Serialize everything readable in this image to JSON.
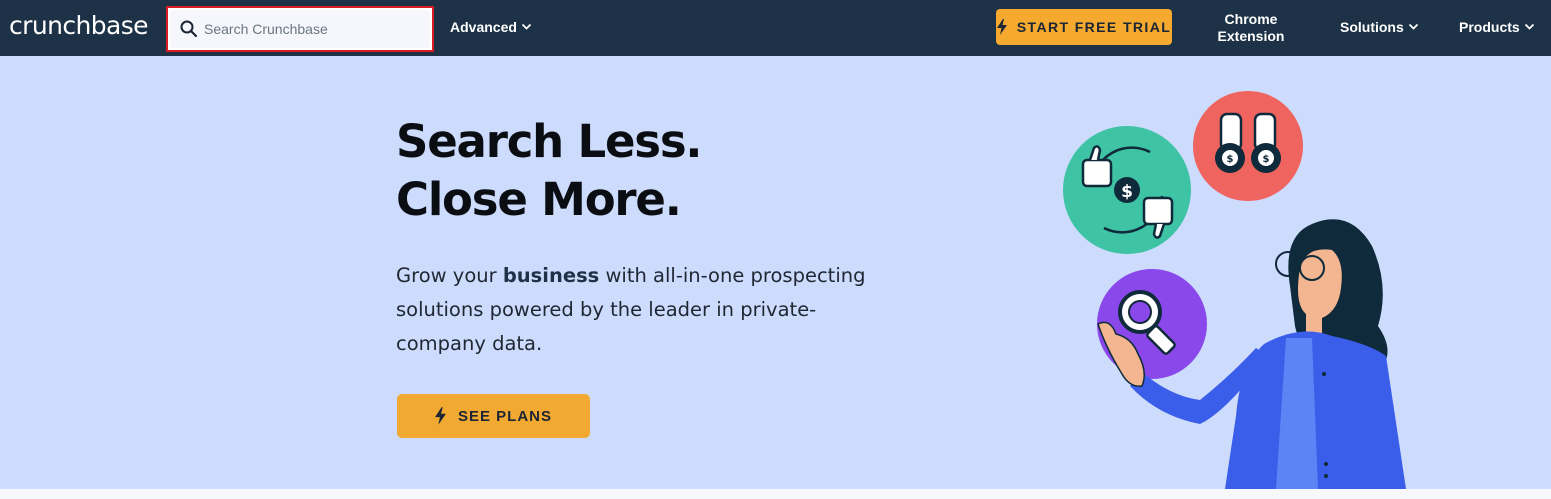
{
  "nav": {
    "logo": "crunchbase",
    "search_placeholder": "Search Crunchbase",
    "advanced": "Advanced",
    "trial": "START FREE TRIAL",
    "chrome_line1": "Chrome",
    "chrome_line2": "Extension",
    "solutions": "Solutions",
    "products": "Products"
  },
  "hero": {
    "headline_line1": "Search Less.",
    "headline_line2": "Close More.",
    "sub_before": "Grow your ",
    "sub_bold": "business",
    "sub_after": " with all-in-one prospecting solutions powered by the leader in private-company data.",
    "cta": "SEE PLANS"
  },
  "colors": {
    "nav_bg": "#1d3246",
    "hero_bg": "#cddbfd",
    "accent": "#f5a92f",
    "focus_outline": "#d81b24"
  },
  "icons": [
    "search-icon",
    "chevron-down-icon",
    "lightning-bolt-icon",
    "thumbs-up-icon",
    "thumbs-down-icon",
    "dollar-icon",
    "binoculars-icon",
    "magnifier-icon"
  ]
}
